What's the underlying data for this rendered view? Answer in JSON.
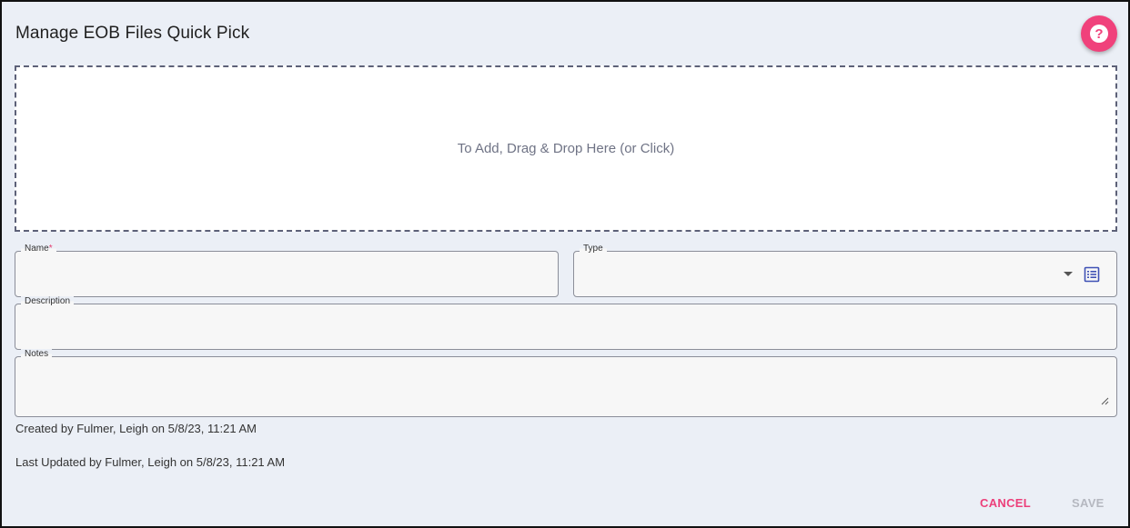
{
  "dialog": {
    "title": "Manage EOB Files Quick Pick",
    "help_icon": "help-question-icon",
    "accent_color": "#f0417b"
  },
  "dropzone": {
    "text": "To Add, Drag & Drop Here (or Click)"
  },
  "form": {
    "name": {
      "label": "Name",
      "required_marker": "*",
      "value": ""
    },
    "type": {
      "label": "Type",
      "value": "",
      "icons": [
        "dropdown-arrow-icon",
        "list-details-icon"
      ]
    },
    "description": {
      "label": "Description",
      "value": ""
    },
    "notes": {
      "label": "Notes",
      "value": ""
    }
  },
  "meta": {
    "created": "Created by Fulmer, Leigh on 5/8/23, 11:21 AM",
    "updated": "Last Updated by Fulmer, Leigh on 5/8/23, 11:21 AM"
  },
  "actions": {
    "cancel_label": "CANCEL",
    "save_label": "SAVE",
    "save_enabled": false
  }
}
